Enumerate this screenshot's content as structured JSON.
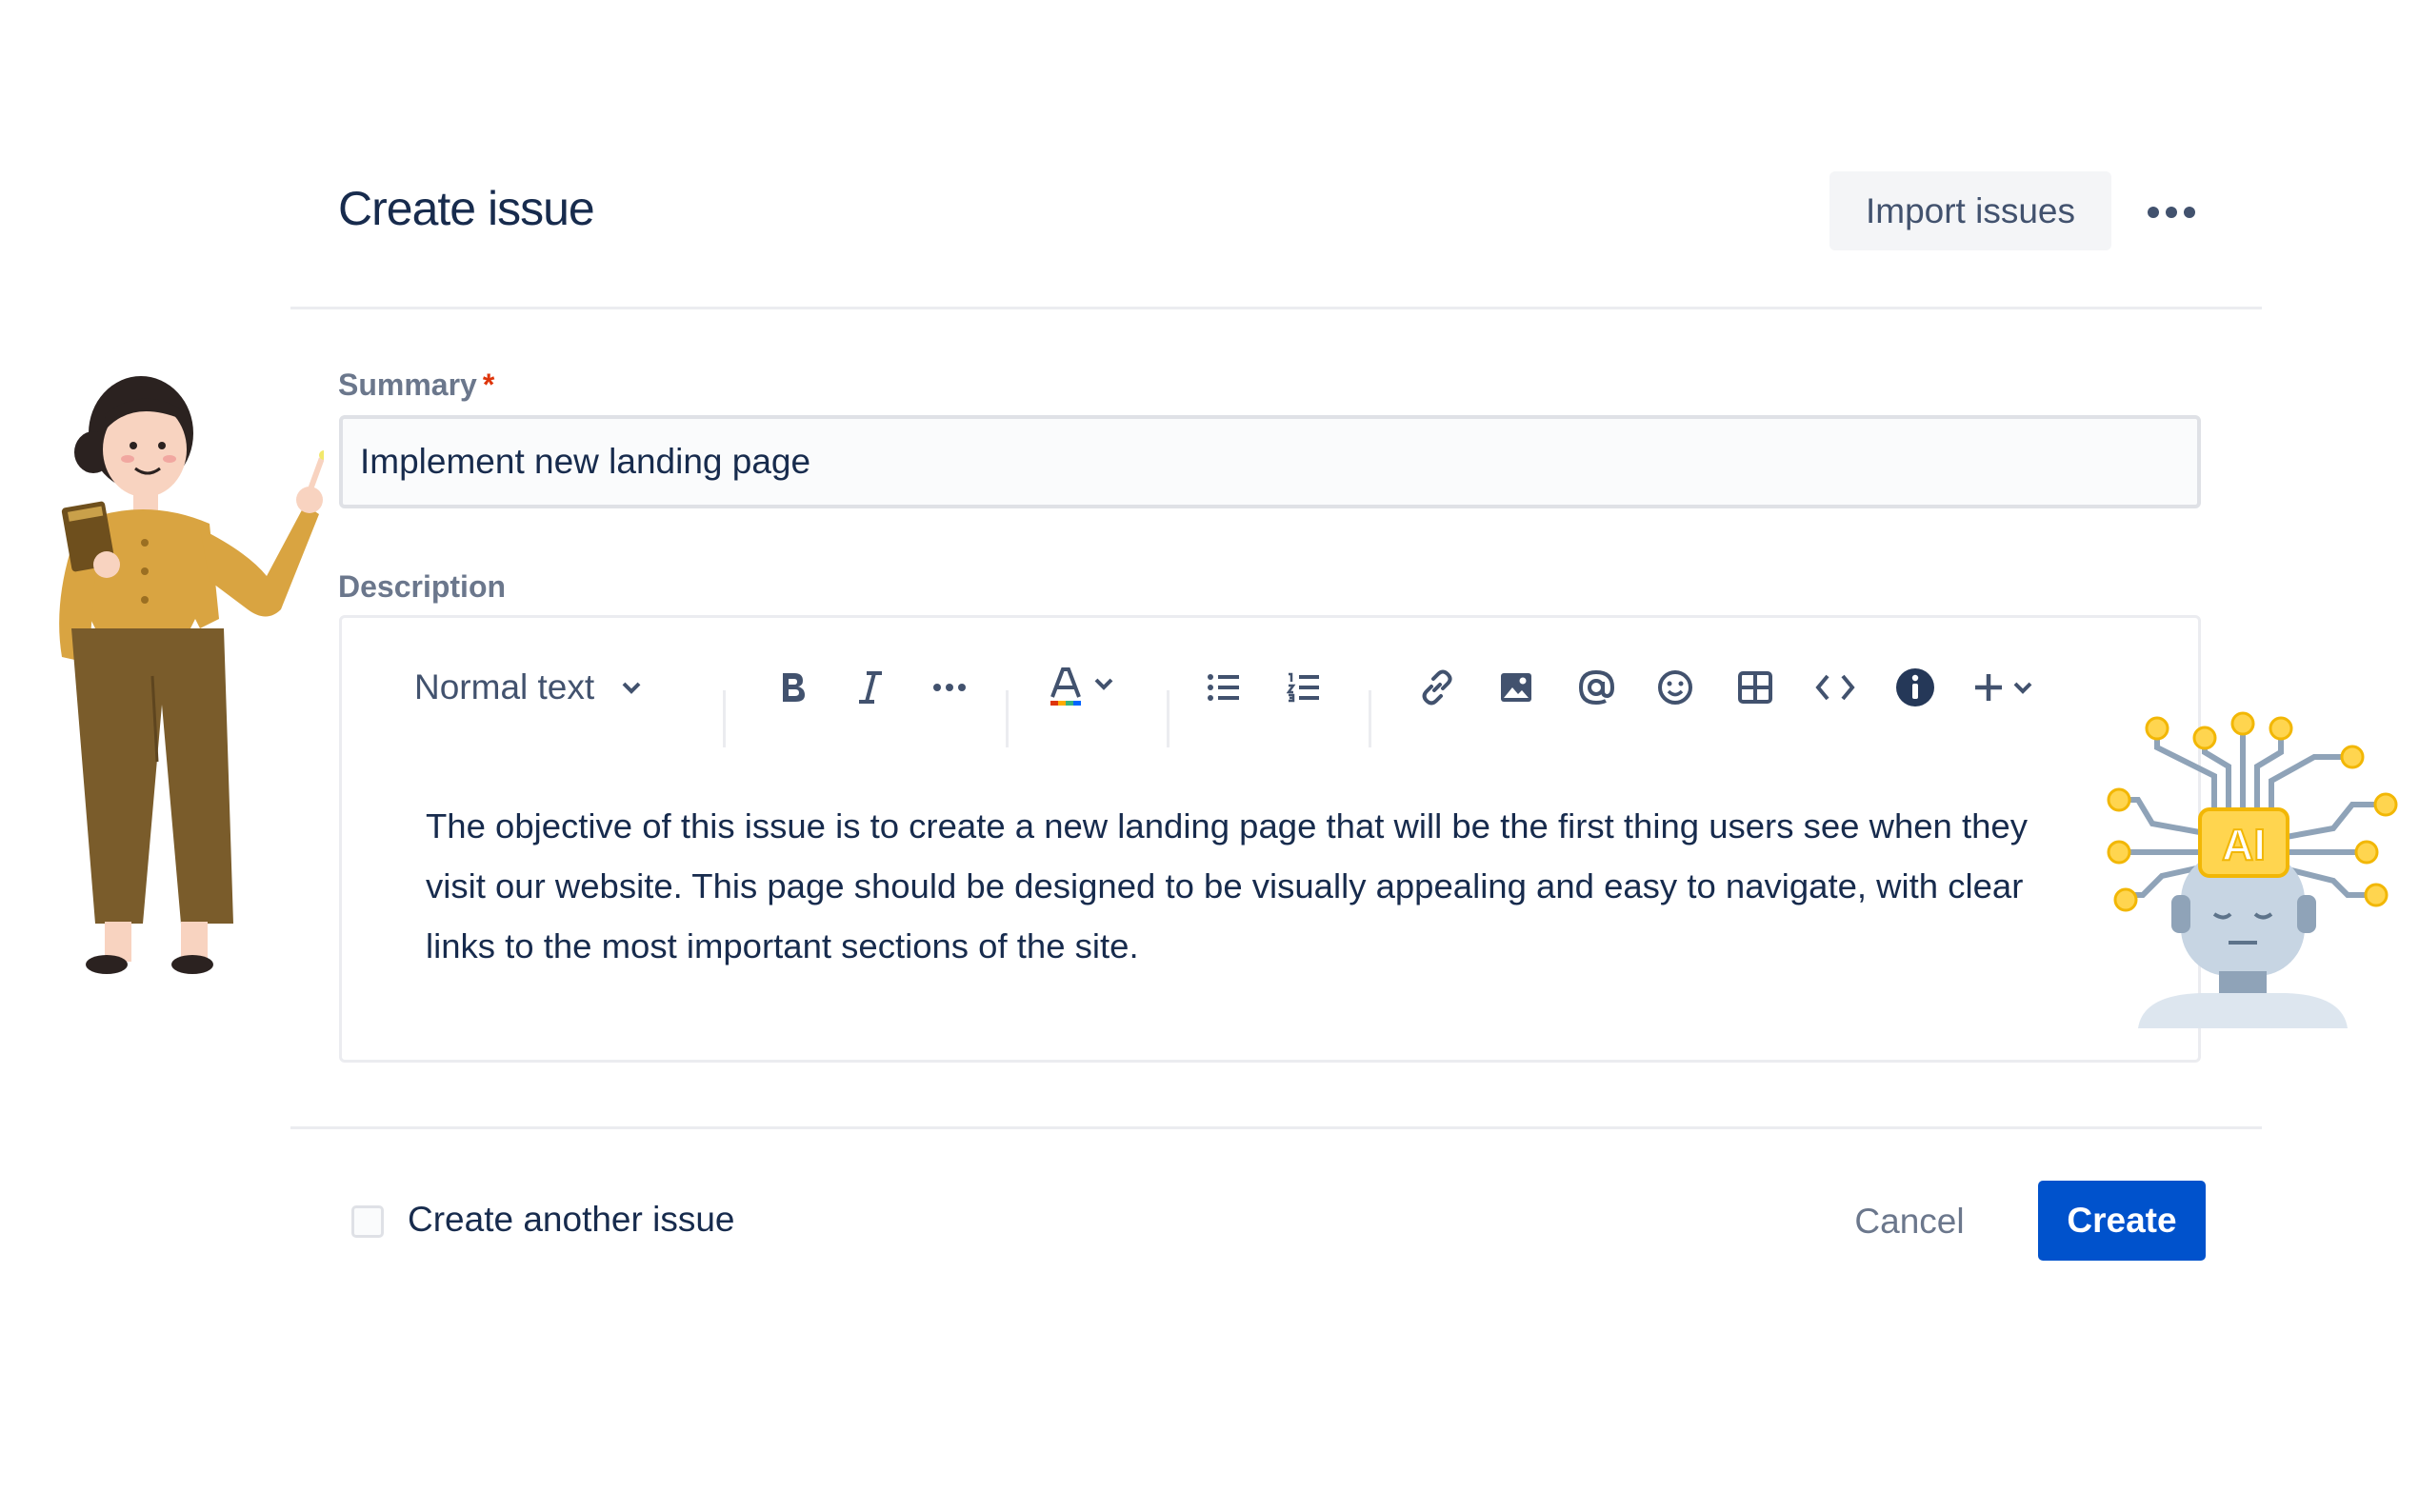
{
  "dialog": {
    "title": "Create issue",
    "import_label": "Import issues",
    "more_icon": "more-horizontal-icon"
  },
  "summary": {
    "label": "Summary",
    "required_mark": "*",
    "value": "Implement new landing page"
  },
  "description": {
    "label": "Description",
    "toolbar": {
      "text_style": "Normal text",
      "icons": [
        "chevron-down-icon",
        "bold-icon",
        "italic-icon",
        "more-formatting-icon",
        "text-color-icon",
        "bullet-list-icon",
        "numbered-list-icon",
        "link-icon",
        "image-icon",
        "mention-icon",
        "emoji-icon",
        "table-icon",
        "code-icon",
        "info-icon",
        "insert-plus-icon"
      ]
    },
    "lines": [
      "The objective of this issue is to create a new landing page that will be the first thing users see when they",
      "visit our website. This page should be designed to be visually appealing and easy to navigate, with clear",
      "links to the most important sections of the site."
    ]
  },
  "footer": {
    "create_another_label": "Create another issue",
    "create_another_checked": false,
    "cancel_label": "Cancel",
    "create_label": "Create"
  },
  "colors": {
    "primary": "#0052cc",
    "text": "#172b4d",
    "subtle": "#6b778c",
    "required": "#de350b"
  },
  "illustrations": [
    "woman-pointing-illustration",
    "ai-robot-head-illustration"
  ],
  "ai_badge_text": "AI"
}
